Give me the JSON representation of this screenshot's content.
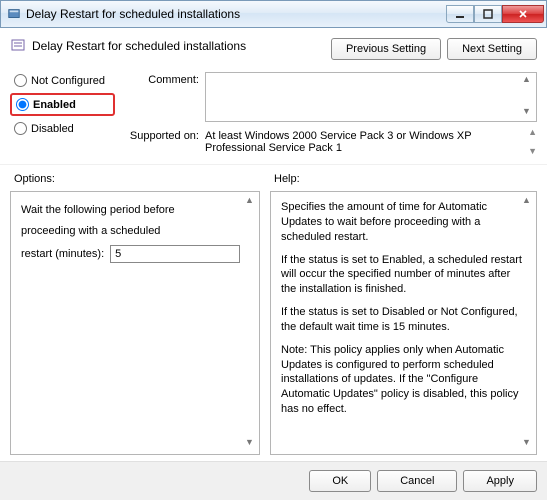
{
  "window": {
    "title": "Delay Restart for scheduled installations"
  },
  "header": {
    "title": "Delay Restart for scheduled installations",
    "prev_button": "Previous Setting",
    "next_button": "Next Setting"
  },
  "radios": {
    "not_configured": "Not Configured",
    "enabled": "Enabled",
    "disabled": "Disabled",
    "selected": "enabled"
  },
  "fields": {
    "comment_label": "Comment:",
    "comment_value": "",
    "supported_label": "Supported on:",
    "supported_value": "At least Windows 2000 Service Pack 3 or Windows XP Professional Service Pack 1"
  },
  "sections": {
    "options_label": "Options:",
    "help_label": "Help:"
  },
  "options_pane": {
    "line1": "Wait the following period before",
    "line2": "proceeding with a scheduled",
    "restart_label": "restart (minutes):",
    "restart_value": "5"
  },
  "help_pane": {
    "p1": "Specifies the amount of time for Automatic Updates to wait before proceeding with a scheduled restart.",
    "p2": "If the status is set to Enabled, a scheduled restart will occur the specified number of minutes after the installation is finished.",
    "p3": "If the status is set to Disabled or Not Configured, the default wait time is 15 minutes.",
    "p4": "Note: This policy applies only when Automatic Updates is configured to perform scheduled installations of updates. If the \"Configure Automatic Updates\" policy is disabled, this policy has no effect."
  },
  "footer": {
    "ok": "OK",
    "cancel": "Cancel",
    "apply": "Apply"
  }
}
